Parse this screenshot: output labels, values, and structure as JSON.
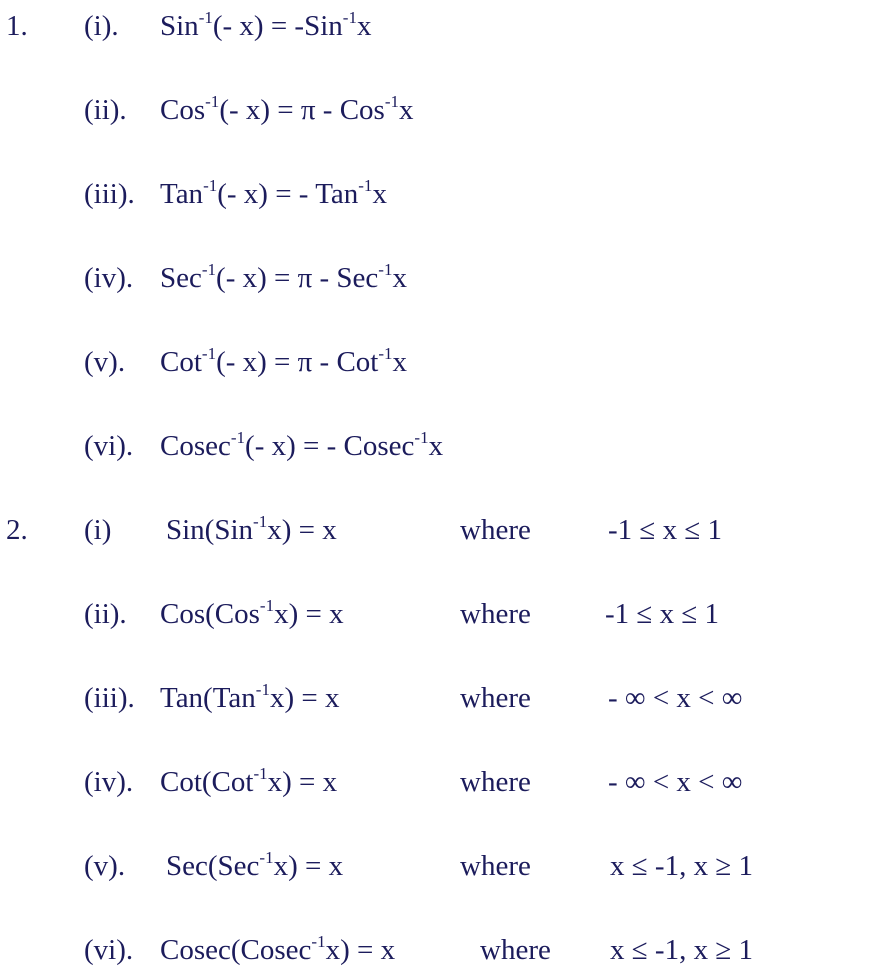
{
  "sections": [
    {
      "number": "1.",
      "items": [
        {
          "label": "(i).",
          "pre": "Sin",
          "sup1": "-1",
          "mid": "(- x) = -Sin",
          "sup2": "-1",
          "post": "x"
        },
        {
          "label": "(ii).",
          "pre": "Cos",
          "sup1": "-1",
          "mid": "(- x) = π - Cos",
          "sup2": "-1",
          "post": "x"
        },
        {
          "label": "(iii).",
          "pre": "Tan",
          "sup1": "-1",
          "mid": "(- x) = - Tan",
          "sup2": "-1",
          "post": "x"
        },
        {
          "label": "(iv).",
          "pre": "Sec",
          "sup1": "-1",
          "mid": "(- x) = π - Sec",
          "sup2": "-1",
          "post": "x"
        },
        {
          "label": "(v).",
          "pre": "Cot",
          "sup1": "-1",
          "mid": "(- x) = π - Cot",
          "sup2": "-1",
          "post": "x"
        },
        {
          "label": "(vi).",
          "pre": "Cosec",
          "sup1": "-1",
          "mid": "(- x) = - Cosec",
          "sup2": "-1",
          "post": "x"
        }
      ]
    },
    {
      "number": "2.",
      "items": [
        {
          "label": "(i)",
          "pre": "Sin(Sin",
          "sup1": "-1",
          "mid": "x) = x",
          "where": "where",
          "cond": "-1 ≤ x ≤ 1"
        },
        {
          "label": "(ii).",
          "pre": "Cos(Cos",
          "sup1": "-1",
          "mid": "x) = x",
          "where": "where",
          "cond": "-1 ≤ x ≤ 1"
        },
        {
          "label": "(iii).",
          "pre": "Tan(Tan",
          "sup1": "-1",
          "mid": "x) = x",
          "where": "where",
          "cond": "- ∞ < x < ∞"
        },
        {
          "label": "(iv).",
          "pre": "Cot(Cot",
          "sup1": "-1",
          "mid": "x) = x",
          "where": "where",
          "cond": "- ∞ < x < ∞"
        },
        {
          "label": "(v).",
          "pre": "Sec(Sec",
          "sup1": "-1",
          "mid": "x) = x",
          "where": "where",
          "cond": "x ≤ -1,  x ≥ 1"
        },
        {
          "label": "(vi).",
          "pre": "Cosec(Cosec",
          "sup1": "-1",
          "mid": "x) = x",
          "where": "where",
          "cond": "x ≤ -1,  x ≥ 1"
        }
      ]
    }
  ]
}
